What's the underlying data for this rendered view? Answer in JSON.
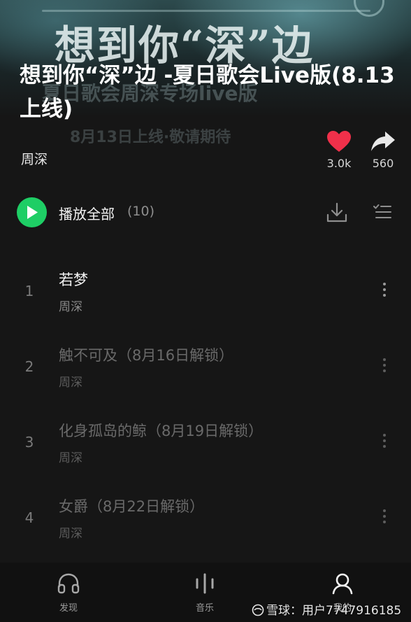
{
  "cover": {
    "art_title": "想到你“深”边",
    "art_line1": "夏日歌会周深专场live版",
    "art_line2": "8月13日上线·敬请期待"
  },
  "album": {
    "title": "想到你“深”边 -夏日歌会Live版(8.13上线)",
    "artist": "周深",
    "likes": "3.0k",
    "shares": "560"
  },
  "play_all": {
    "label": "播放全部",
    "count": "(10)"
  },
  "tracks": [
    {
      "index": "1",
      "title": "若梦",
      "artist": "周深",
      "locked": false
    },
    {
      "index": "2",
      "title": "触不可及（8月16日解锁）",
      "artist": "周深",
      "locked": true
    },
    {
      "index": "3",
      "title": "化身孤岛的鲸（8月19日解锁）",
      "artist": "周深",
      "locked": true
    },
    {
      "index": "4",
      "title": "女爵（8月22日解锁）",
      "artist": "周深",
      "locked": true
    }
  ],
  "nav": {
    "discover": "发现",
    "music": "音乐",
    "mine": "我的"
  },
  "watermark": "雪球：用户7747916185",
  "colors": {
    "accent_green": "#1ece65",
    "like_red": "#f0304a",
    "background": "#161616"
  },
  "icons": {
    "like": "heart-icon",
    "share": "share-arrow-icon",
    "play": "play-icon",
    "download": "download-icon",
    "multiselect": "checklist-icon",
    "more": "more-vertical-icon",
    "discover": "headphones-icon",
    "music": "equalizer-icon",
    "mine": "user-icon"
  }
}
